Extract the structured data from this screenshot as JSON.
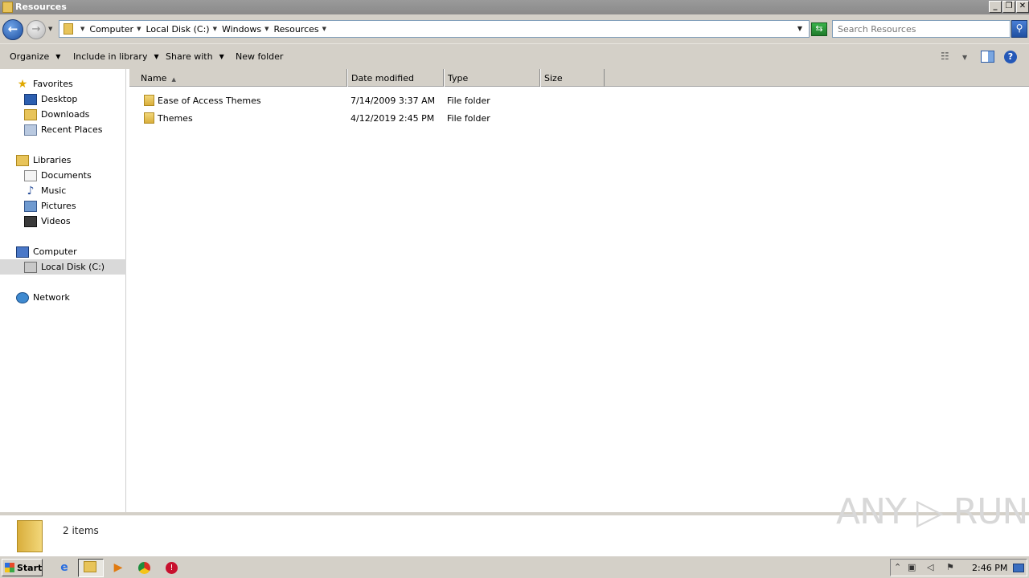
{
  "window": {
    "title": "Resources",
    "buttons": {
      "minimize": "_",
      "restore": "❐",
      "close": "✕"
    }
  },
  "address": {
    "crumbs": [
      "Computer",
      "Local Disk (C:)",
      "Windows",
      "Resources"
    ],
    "search_placeholder": "Search Resources"
  },
  "toolbar": {
    "organize": "Organize",
    "include_in_library": "Include in library",
    "share_with": "Share with",
    "new_folder": "New folder",
    "help": "?"
  },
  "nav": {
    "favorites_header": "Favorites",
    "favorites": [
      "Desktop",
      "Downloads",
      "Recent Places"
    ],
    "libraries_header": "Libraries",
    "libraries": [
      "Documents",
      "Music",
      "Pictures",
      "Videos"
    ],
    "computer_header": "Computer",
    "computer": [
      "Local Disk (C:)"
    ],
    "network_header": "Network"
  },
  "columns": {
    "name": "Name",
    "date_modified": "Date modified",
    "type": "Type",
    "size": "Size"
  },
  "files": [
    {
      "name": "Ease of Access Themes",
      "date_modified": "7/14/2009 3:37 AM",
      "type": "File folder",
      "size": ""
    },
    {
      "name": "Themes",
      "date_modified": "4/12/2019 2:45 PM",
      "type": "File folder",
      "size": ""
    }
  ],
  "details": {
    "item_count": "2 items"
  },
  "watermark": "ANY ▷ RUN",
  "taskbar": {
    "start_label": "Start",
    "clock": "2:46 PM"
  },
  "colors": {
    "title_bar": "#8a8a8a",
    "chrome": "#d4d0c8",
    "selection": "#d9d9d9"
  }
}
